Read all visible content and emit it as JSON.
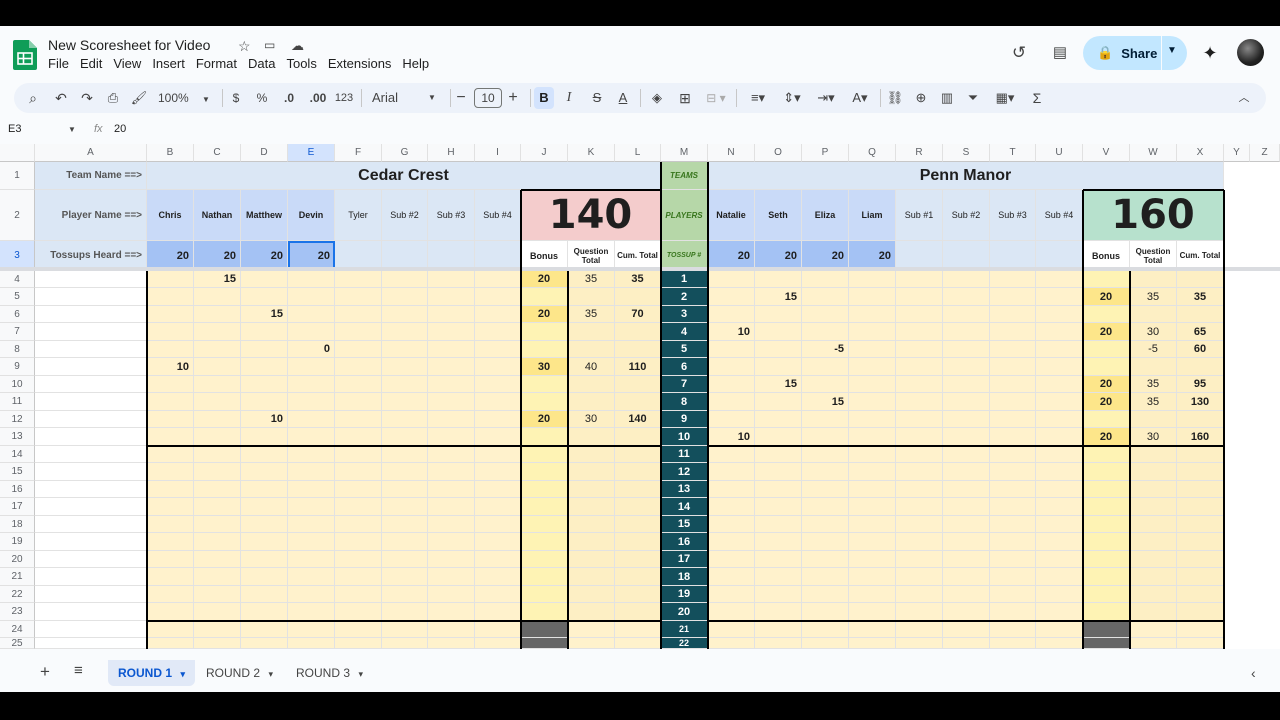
{
  "doc": {
    "title": "New Scoresheet for Video"
  },
  "menu": [
    "File",
    "Edit",
    "View",
    "Insert",
    "Format",
    "Data",
    "Tools",
    "Extensions",
    "Help"
  ],
  "share_label": "Share",
  "toolbar": {
    "zoom": "100%",
    "currency": "$",
    "percent": "%",
    "dec_decrease": ".0",
    "dec_increase": ".00",
    "number_format": "123",
    "font": "Arial",
    "font_size": "10",
    "bold": "B",
    "italic": "I"
  },
  "formula": {
    "cell": "E3",
    "fx": "fx",
    "value": "20"
  },
  "columns": [
    "A",
    "B",
    "C",
    "D",
    "E",
    "F",
    "G",
    "H",
    "I",
    "J",
    "K",
    "L",
    "M",
    "N",
    "O",
    "P",
    "Q",
    "R",
    "S",
    "T",
    "U",
    "V",
    "W",
    "X",
    "Y",
    "Z"
  ],
  "rows": [
    "1",
    "2",
    "3",
    "4",
    "5",
    "6",
    "7",
    "8",
    "9",
    "10",
    "11",
    "12",
    "13",
    "14",
    "15",
    "16",
    "17",
    "18",
    "19",
    "20",
    "21",
    "22",
    "23",
    "24",
    "25"
  ],
  "labels": {
    "team": "Team Name ==>",
    "player": "Player Name ==>",
    "tossups_heard": "Tossups Heard ==>"
  },
  "teams": [
    {
      "name": "Cedar Crest",
      "score": "140",
      "players": [
        "Chris",
        "Nathan",
        "Matthew",
        "Devin",
        "Tyler",
        "Sub #2",
        "Sub #3",
        "Sub #4"
      ],
      "heard": [
        "20",
        "20",
        "20",
        "20",
        "",
        "",
        "",
        ""
      ]
    },
    {
      "name": "Penn Manor",
      "score": "160",
      "players": [
        "Natalie",
        "Seth",
        "Eliza",
        "Liam",
        "Sub #1",
        "Sub #2",
        "Sub #3",
        "Sub #4"
      ],
      "heard": [
        "20",
        "20",
        "20",
        "20",
        "",
        "",
        "",
        ""
      ]
    }
  ],
  "middle": {
    "teams": "TEAMS",
    "players": "PLAYERS",
    "tossup": "TOSSUP #"
  },
  "score_headers": {
    "bonus": "Bonus",
    "question_total": "Question Total",
    "cum_total": "Cum. Total"
  },
  "tossups": [
    "1",
    "2",
    "3",
    "4",
    "5",
    "6",
    "7",
    "8",
    "9",
    "10",
    "11",
    "12",
    "13",
    "14",
    "15",
    "16",
    "17",
    "18",
    "19",
    "20",
    "21",
    "22"
  ],
  "left_cells": [
    {
      "row": 4,
      "col": "C",
      "v": "15"
    },
    {
      "row": 6,
      "col": "D",
      "v": "15"
    },
    {
      "row": 8,
      "col": "E",
      "v": "0"
    },
    {
      "row": 9,
      "col": "B",
      "v": "10"
    },
    {
      "row": 12,
      "col": "D",
      "v": "10"
    }
  ],
  "left_scores": [
    {
      "row": 4,
      "bonus": "20",
      "qt": "35",
      "cum": "35"
    },
    {
      "row": 6,
      "bonus": "20",
      "qt": "35",
      "cum": "70"
    },
    {
      "row": 9,
      "bonus": "30",
      "qt": "40",
      "cum": "110"
    },
    {
      "row": 12,
      "bonus": "20",
      "qt": "30",
      "cum": "140"
    }
  ],
  "right_cells": [
    {
      "row": 5,
      "col": "O",
      "v": "15"
    },
    {
      "row": 7,
      "col": "N",
      "v": "10"
    },
    {
      "row": 8,
      "col": "P",
      "v": "-5"
    },
    {
      "row": 10,
      "col": "O",
      "v": "15"
    },
    {
      "row": 11,
      "col": "P",
      "v": "15"
    },
    {
      "row": 13,
      "col": "N",
      "v": "10"
    }
  ],
  "right_scores": [
    {
      "row": 5,
      "bonus": "20",
      "qt": "35",
      "cum": "35"
    },
    {
      "row": 7,
      "bonus": "20",
      "qt": "30",
      "cum": "65"
    },
    {
      "row": 8,
      "bonus": "",
      "qt": "-5",
      "cum": "60"
    },
    {
      "row": 10,
      "bonus": "20",
      "qt": "35",
      "cum": "95"
    },
    {
      "row": 11,
      "bonus": "20",
      "qt": "35",
      "cum": "130"
    },
    {
      "row": 13,
      "bonus": "20",
      "qt": "30",
      "cum": "160"
    }
  ],
  "sheets": [
    {
      "name": "ROUND 1",
      "active": true
    },
    {
      "name": "ROUND 2",
      "active": false
    },
    {
      "name": "ROUND 3",
      "active": false
    }
  ],
  "colors": {
    "cedar_score_bg": "#f4cccc",
    "penn_score_bg": "#b7e1cd",
    "teal": "#134f5c",
    "cream": "#fff2cc",
    "header_blue": "#dbe7f5"
  }
}
